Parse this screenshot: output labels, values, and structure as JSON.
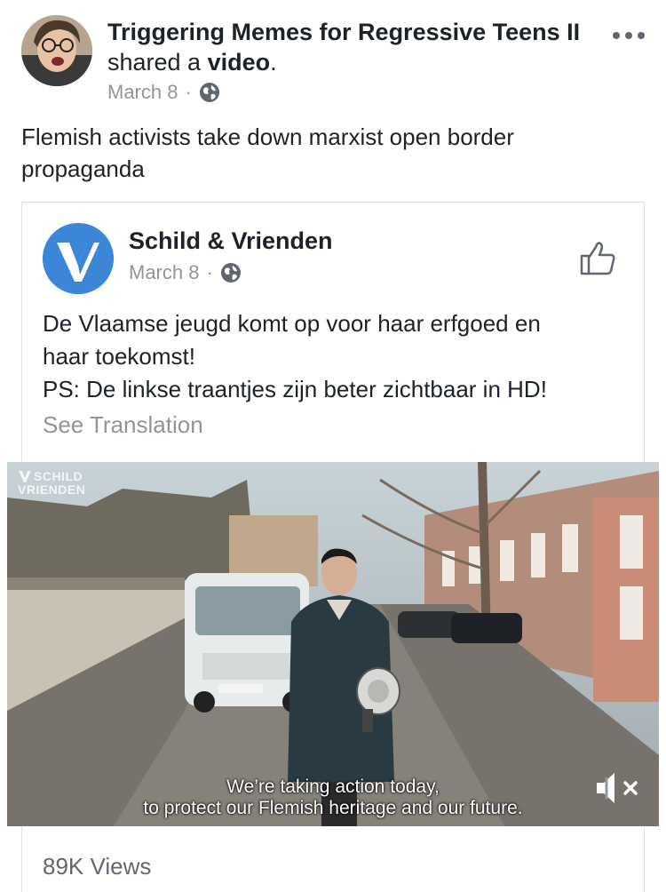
{
  "post": {
    "poster_name": "Triggering Memes for Regressive Teens II",
    "action_text": "shared a",
    "action_object": "video",
    "action_end": ".",
    "date": "March 8",
    "date_separator": "·",
    "privacy_icon": "globe-icon",
    "more_icon": "more-options-icon",
    "text": "Flemish activists take down marxist open border propaganda"
  },
  "shared": {
    "page_name": "Schild & Vrienden",
    "date": "March 8",
    "date_separator": "·",
    "privacy_icon": "globe-icon",
    "like_icon": "thumbs-up-icon",
    "text_line1": "De Vlaamse jeugd komt op voor haar erfgoed en",
    "text_line2": "haar toekomst!",
    "text_line3": "PS: De linkse traantjes zijn beter zichtbaar in HD!",
    "see_translation": "See Translation"
  },
  "video": {
    "logo_line1": "SCHILD",
    "logo_line2": "VRIENDEN",
    "subtitle_line1": "We’re taking action today,",
    "subtitle_line2": "to protect our Flemish heritage and our future.",
    "mute_icon": "speaker-muted-icon",
    "views": "89K Views"
  },
  "colors": {
    "text_primary": "#1d2129",
    "text_secondary": "#90949c",
    "border": "#dddfe2",
    "page_avatar_blue": "#3b86d6"
  }
}
